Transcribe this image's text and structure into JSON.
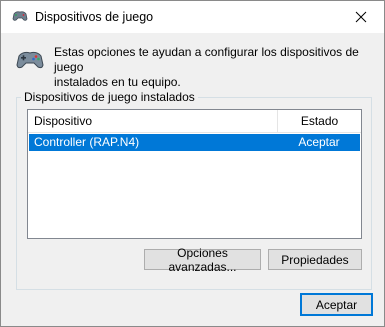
{
  "window": {
    "title": "Dispositivos de juego",
    "icon": "gamepad-icon",
    "close_icon": "close-icon"
  },
  "header": {
    "icon": "gamepad-icon",
    "description_line1": "Estas opciones te ayudan a configurar los dispositivos de juego",
    "description_line2": "instalados en tu equipo."
  },
  "group": {
    "legend": "Dispositivos de juego instalados",
    "columns": [
      "Dispositivo",
      "Estado"
    ],
    "rows": [
      {
        "device": "Controller (RAP.N4)",
        "status": "Aceptar",
        "selected": true
      }
    ]
  },
  "buttons": {
    "advanced": "Opciones avanzadas...",
    "properties": "Propiedades",
    "ok": "Aceptar"
  },
  "background": {
    "letter": "s"
  },
  "colors": {
    "selection": "#0078d7",
    "selection_text": "#ffffff",
    "dialog_bg": "#f0f0f0",
    "titlebar_bg": "#ffffff"
  }
}
